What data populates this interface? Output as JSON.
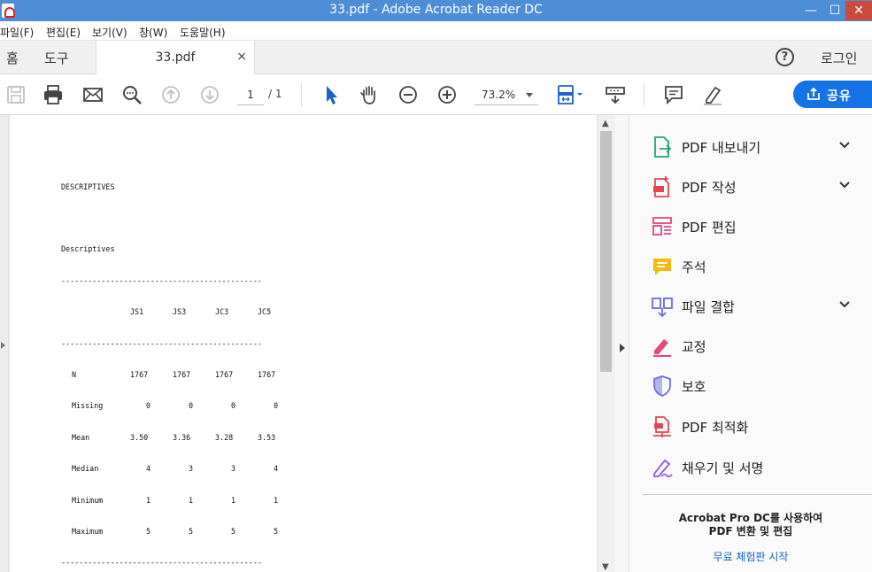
{
  "window": {
    "title": "33.pdf - Adobe Acrobat Reader DC",
    "min": "—",
    "max": "☐",
    "close": "✕"
  },
  "menu": [
    {
      "label": "파일(F)"
    },
    {
      "label": "편집(E)"
    },
    {
      "label": "보기(V)"
    },
    {
      "label": "창(W)"
    },
    {
      "label": "도움말(H)"
    }
  ],
  "tabs": {
    "home": "홈",
    "tools": "도구",
    "doc": "33.pdf",
    "close": "×",
    "help": "?",
    "login": "로그인"
  },
  "toolbar": {
    "page_current": "1",
    "page_total": "/ 1",
    "zoom": "73.2%",
    "share": "공유",
    "icons": [
      "save-icon",
      "print-icon",
      "email-icon",
      "find-icon",
      "prev-page-icon",
      "next-page-icon",
      "select-arrow-icon",
      "hand-icon",
      "zoom-out-icon",
      "zoom-in-icon",
      "fit-page-icon",
      "scroll-mode-icon",
      "comment-icon",
      "highlight-pen-icon"
    ],
    "accent": "#1473e6"
  },
  "document": {
    "heading": "DESCRIPTIVES",
    "subheading": "Descriptives",
    "rule": "---------------------------------------------",
    "columns": [
      "JS1",
      "JS3",
      "JC3",
      "JC5"
    ],
    "rows": [
      {
        "label": "N",
        "values": [
          "1767",
          "1767",
          "1767",
          "1767"
        ]
      },
      {
        "label": "Missing",
        "values": [
          "0",
          "0",
          "0",
          "0"
        ]
      },
      {
        "label": "Mean",
        "values": [
          "3.50",
          "3.36",
          "3.28",
          "3.53"
        ]
      },
      {
        "label": "Median",
        "values": [
          "4",
          "3",
          "3",
          "4"
        ]
      },
      {
        "label": "Minimum",
        "values": [
          "1",
          "1",
          "1",
          "1"
        ]
      },
      {
        "label": "Maximum",
        "values": [
          "5",
          "5",
          "5",
          "5"
        ]
      }
    ]
  },
  "tools": [
    {
      "label": "PDF 내보내기",
      "icon": "export-pdf-icon",
      "expandable": true,
      "color": "#21a67a"
    },
    {
      "label": "PDF 작성",
      "icon": "create-pdf-icon",
      "expandable": true,
      "color": "#e34850"
    },
    {
      "label": "PDF 편집",
      "icon": "edit-pdf-icon",
      "expandable": false,
      "color": "#e34880"
    },
    {
      "label": "주석",
      "icon": "comment-tool-icon",
      "expandable": false,
      "color": "#f2b914"
    },
    {
      "label": "파일 결합",
      "icon": "combine-files-icon",
      "expandable": true,
      "color": "#6d6de4"
    },
    {
      "label": "교정",
      "icon": "redact-icon",
      "expandable": false,
      "color": "#e34880"
    },
    {
      "label": "보호",
      "icon": "protect-icon",
      "expandable": false,
      "color": "#6d6de4"
    },
    {
      "label": "PDF 최적화",
      "icon": "optimize-pdf-icon",
      "expandable": false,
      "color": "#e34850"
    },
    {
      "label": "채우기 및 서명",
      "icon": "fill-sign-icon",
      "expandable": false,
      "color": "#9356e0"
    }
  ],
  "promo": {
    "line1": "Acrobat Pro DC를 사용하여",
    "line2": "PDF 변환 및 편집",
    "trial": "무료 체험판 시작"
  }
}
